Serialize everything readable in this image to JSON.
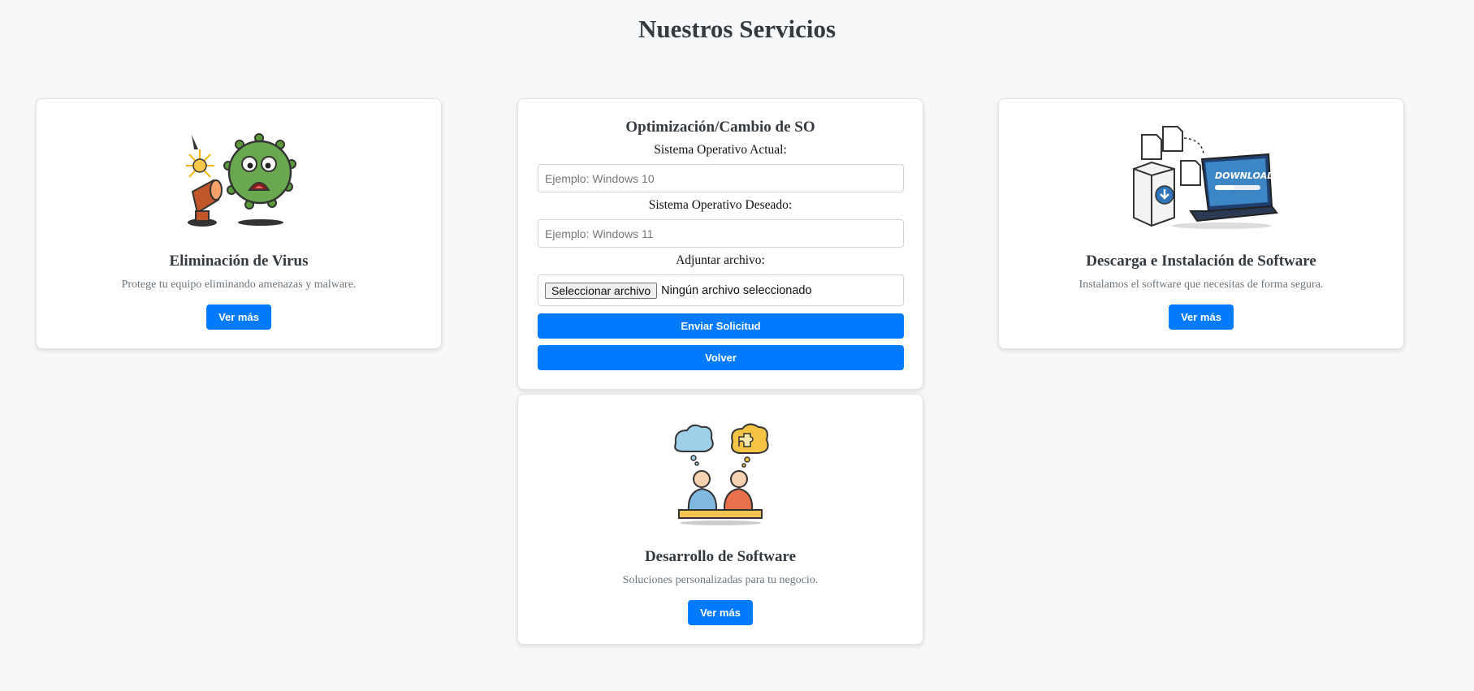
{
  "page": {
    "title": "Nuestros Servicios"
  },
  "colors": {
    "primary": "#007bff",
    "background": "#f7f8fa",
    "card": "#ffffff"
  },
  "cards": {
    "virus": {
      "icon": "virus-removal-illustration",
      "title": "Eliminación de Virus",
      "description": "Protege tu equipo eliminando amenazas y malware.",
      "button": "Ver más"
    },
    "download": {
      "icon": "software-download-illustration",
      "title": "Descarga e Instalación de Software",
      "description": "Instalamos el software que necesitas de forma segura.",
      "button": "Ver más",
      "image_text": "DOWNLOAD"
    },
    "dev": {
      "icon": "software-development-illustration",
      "title": "Desarrollo de Software",
      "description": "Soluciones personalizadas para tu negocio.",
      "button": "Ver más"
    }
  },
  "form": {
    "title": "Optimización/Cambio de SO",
    "current_os_label": "Sistema Operativo Actual:",
    "current_os_placeholder": "Ejemplo: Windows 10",
    "desired_os_label": "Sistema Operativo Deseado:",
    "desired_os_placeholder": "Ejemplo: Windows 11",
    "file_label": "Adjuntar archivo:",
    "file_button": "Seleccionar archivo",
    "file_status": "Ningún archivo seleccionado",
    "submit_button": "Enviar Solicitud",
    "back_button": "Volver"
  }
}
